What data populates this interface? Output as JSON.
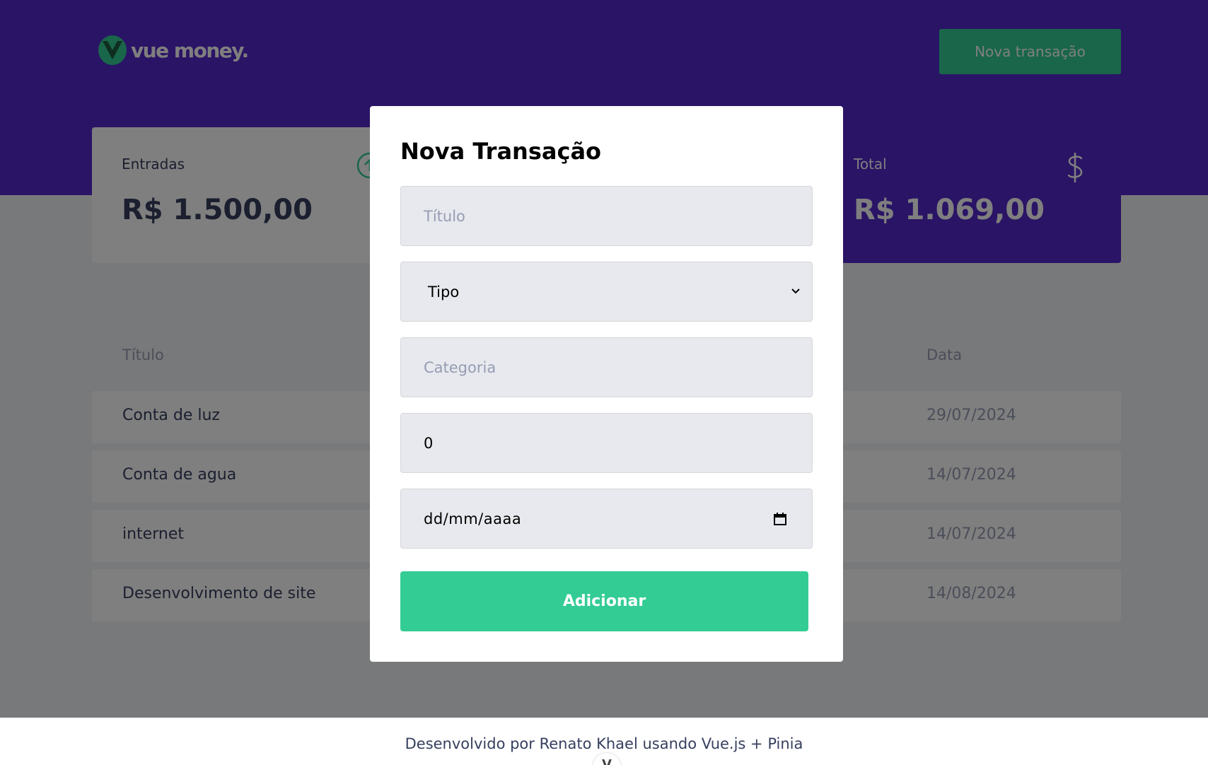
{
  "header": {
    "logo_text": "vue money.",
    "new_transaction_label": "Nova transação"
  },
  "summary": {
    "income_label": "Entradas",
    "income_value": "R$ 1.500,00",
    "total_label": "Total",
    "total_value": "R$ 1.069,00"
  },
  "table": {
    "headers": [
      "Título",
      "Data"
    ],
    "rows": [
      {
        "title": "Conta de luz",
        "date": "29/07/2024"
      },
      {
        "title": "Conta de agua",
        "date": "14/07/2024"
      },
      {
        "title": "internet",
        "date": "14/07/2024"
      },
      {
        "title": "Desenvolvimento de site",
        "date": "14/08/2024"
      }
    ]
  },
  "modal": {
    "title": "Nova Transação",
    "title_placeholder": "Título",
    "type_selected": "Tipo",
    "category_placeholder": "Categoria",
    "amount_value": "0",
    "date_placeholder": "dd/mm/aaaa",
    "submit_label": "Adicionar"
  },
  "footer": {
    "text": "Desenvolvido por Renato Khael usando Vue.js + Pinia",
    "badge": "V"
  },
  "colors": {
    "primary": "#5429cc",
    "accent": "#33cc95",
    "text": "#363f5f",
    "muted": "#969cb3"
  }
}
